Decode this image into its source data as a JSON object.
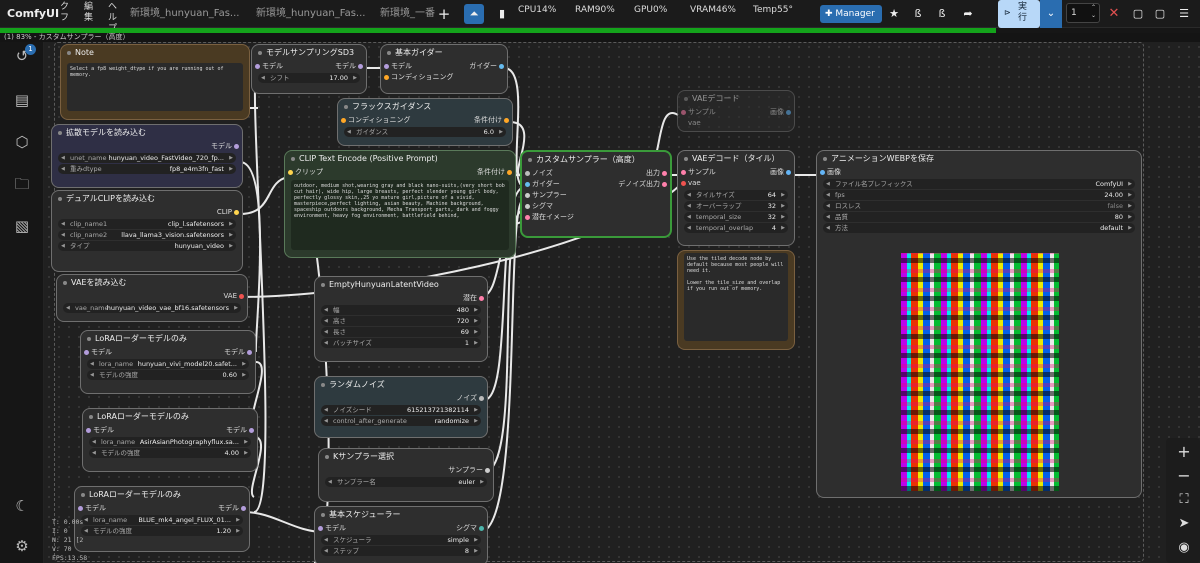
{
  "topbar": {
    "logo": "ComfyUI",
    "menus": [
      "ク フ",
      "編 集",
      "ヘル プ"
    ],
    "tabs": [
      "新環境_hunyuan_Fas...",
      "新環境_hunyuan_Fas...",
      "新環境_一番"
    ],
    "cpu": "CPU14%",
    "ram": "RAM90%",
    "gpu": "GPU0%",
    "vram": "VRAM46%",
    "temp": "Temp55°",
    "manager": "Manager",
    "run": "実 行",
    "batch": "1"
  },
  "progress": {
    "percent": 83
  },
  "status_text": "(1) 83% - カスタムサンプラー（高度）",
  "queue_badge": "1",
  "stats": [
    "T: 0.00s",
    "I: 0",
    "N: 21 [2",
    "V: 70",
    "FPS:13.58"
  ],
  "colors": {
    "run": "#b8d8f8",
    "manager": "#2a6db0",
    "progress": "#14a31b"
  },
  "nodes": {
    "note": {
      "title": "Note",
      "text": "Select a fp8 weight_dtype if you are running out of  memory."
    },
    "msd3": {
      "title": "モデルサンプリングSD3",
      "in": "モデル",
      "out": "モデル",
      "w": "シフト",
      "v": "17.00"
    },
    "guider": {
      "title": "基本ガイダー",
      "in1": "モデル",
      "in2": "コンディショニング",
      "out": "ガイダー"
    },
    "flux": {
      "title": "フラックスガイダンス",
      "in": "コンディショニング",
      "out": "条件付け",
      "w": "ガイダンス",
      "v": "6.0"
    },
    "vaedec": {
      "title": "VAEデコード",
      "in1": "サンプル",
      "in2": "vae",
      "out": "画像"
    },
    "unet": {
      "title": "拡散モデルを読み込む",
      "out": "モデル",
      "w1": "unet_name",
      "v1": "hunyuan_video_FastVideo_720_fp...",
      "w2": "重みdtype",
      "v2": "fp8_e4m3fn_fast"
    },
    "dclip": {
      "title": "デュアルCLIPを読み込む",
      "out": "CLIP",
      "w1": "clip_name1",
      "v1": "clip_l.safetensors",
      "w2": "clip_name2",
      "v2": "llava_llama3_vision.safetensors",
      "w3": "タイプ",
      "v3": "hunyuan_video"
    },
    "clip": {
      "title": "CLIP Text Encode (Positive Prompt)",
      "in": "クリップ",
      "out": "条件付け",
      "text": "outdoor, medium shot,wearing gray and black nano-suits,(very short bob cut hair), wide hip, large breasts, perfect slender young girl body, perfectly glossy skin,,25 yo mature girl,picture of a vivid, masterpiece,perfect lighting, asian beauty, Machine background, spaceship outdoors background, Mecha Transport parts, dark and foggy environment, heavy fog environment, battlefield behind,"
    },
    "csamp": {
      "title": "カスタムサンプラー（高度）",
      "ins": [
        "ノイズ",
        "ガイダー",
        "サンプラー",
        "シグマ",
        "潜在イメージ"
      ],
      "out1": "出力",
      "out2": "デノイズ出力"
    },
    "vaetile": {
      "title": "VAEデコード（タイル）",
      "in1": "サンプル",
      "in2": "vae",
      "out": "画像",
      "ws": [
        [
          "タイルサイズ",
          "64"
        ],
        [
          "オーバーラップ",
          "32"
        ],
        [
          "temporal_size",
          "32"
        ],
        [
          "temporal_overlap",
          "4"
        ]
      ]
    },
    "tilenote": {
      "text": "Use the tiled decode node by default because most people will need it.\n\nLower the tile_size and overlap if you run out of memory."
    },
    "webp": {
      "title": "アニメーションWEBPを保存",
      "in": "画像",
      "prefix_label": "ファイル名プレフィックス",
      "prefix": "ComfyUI",
      "ws": [
        [
          "fps",
          "24.00"
        ],
        [
          "ロスレス",
          "false"
        ],
        [
          "品質",
          "80"
        ],
        [
          "方法",
          "default"
        ]
      ]
    },
    "vaeload": {
      "title": "VAEを読み込む",
      "out": "VAE",
      "w": "vae_name",
      "v": "hunyuan_video_vae_bf16.safetensors"
    },
    "empty": {
      "title": "EmptyHunyuanLatentVideo",
      "out": "潜在",
      "ws": [
        [
          "幅",
          "480"
        ],
        [
          "高さ",
          "720"
        ],
        [
          "長さ",
          "69"
        ],
        [
          "バッチサイズ",
          "1"
        ]
      ]
    },
    "lora1": {
      "title": "LoRAローダーモデルのみ",
      "in": "モデル",
      "out": "モデル",
      "w1": "lora_name",
      "v1": "hunyuan_vivi_model20.safet...",
      "w2": "モデルの強度",
      "v2": "0.60"
    },
    "noise": {
      "title": "ランダムノイズ",
      "out": "ノイズ",
      "w1": "ノイズシード",
      "v1": "615213721382114",
      "w2": "control_after_generate",
      "v2": "randomize"
    },
    "lora2": {
      "title": "LoRAローダーモデルのみ",
      "in": "モデル",
      "out": "モデル",
      "w1": "lora_name",
      "v1": "AsirAsianPhotographyflux.sa...",
      "w2": "モデルの強度",
      "v2": "4.00"
    },
    "ksel": {
      "title": "Kサンプラー選択",
      "out": "サンプラー",
      "w": "サンプラー名",
      "v": "euler"
    },
    "lora3": {
      "title": "LoRAローダーモデルのみ",
      "in": "モデル",
      "out": "モデル",
      "w1": "lora_name",
      "v1": "BLUE_mk4_angel_FLUX_01...",
      "w2": "モデルの強度",
      "v2": "1.20"
    },
    "sched": {
      "title": "基本スケジューラー",
      "in": "モデル",
      "out": "シグマ",
      "w1": "スケジューラ",
      "v1": "simple",
      "w2": "ステップ",
      "v2": "8"
    }
  }
}
